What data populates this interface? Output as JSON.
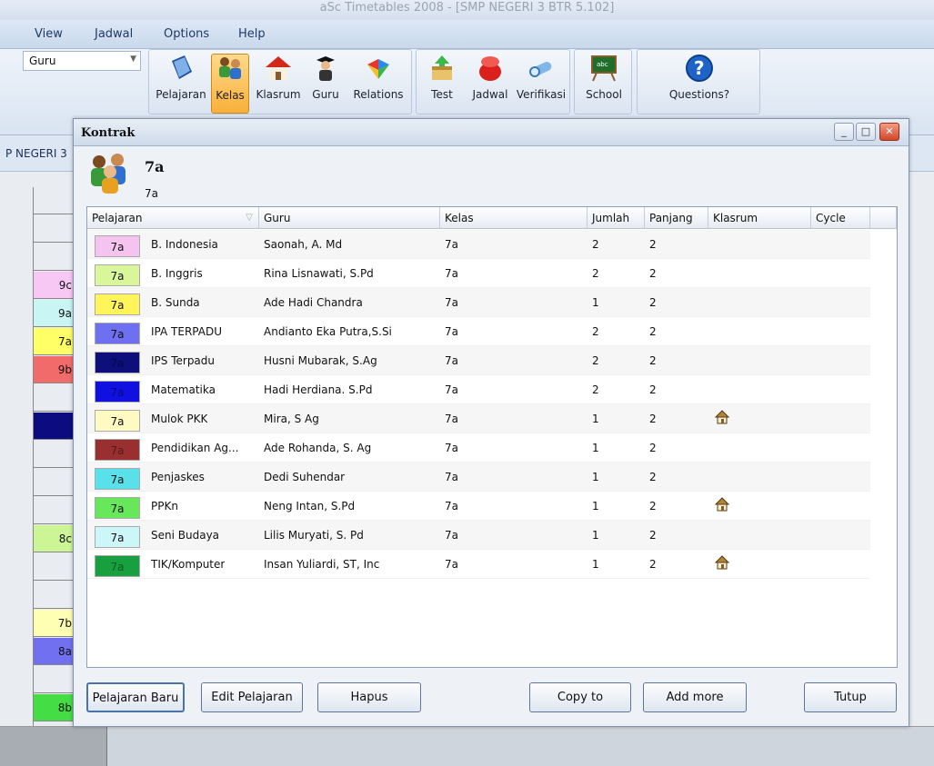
{
  "app": {
    "window_title": "aSc Timetables 2008 - [SMP NEGERI 3 BTR 5.102]",
    "menu": [
      "View",
      "Jadwal",
      "Options",
      "Help"
    ],
    "view_combo": "Guru",
    "school_fragment": "P NEGERI 3"
  },
  "ribbon": {
    "buttons": [
      {
        "label": "Pelajaran",
        "icon": "book-icon"
      },
      {
        "label": "Kelas",
        "icon": "class-students-icon",
        "active": true
      },
      {
        "label": "Klasrum",
        "icon": "house-icon"
      },
      {
        "label": "Guru",
        "icon": "teacher-icon"
      },
      {
        "label": "Relations",
        "icon": "relations-icon"
      },
      {
        "label": "Test",
        "icon": "test-icon"
      },
      {
        "label": "Jadwal",
        "icon": "jadwal-icon"
      },
      {
        "label": "Verifikasi",
        "icon": "verify-icon"
      },
      {
        "label": "School",
        "icon": "blackboard-icon"
      },
      {
        "label": "Questions?",
        "icon": "help-icon"
      }
    ]
  },
  "background_grid": {
    "left_cells": [
      {
        "text": "",
        "color": ""
      },
      {
        "text": "",
        "color": ""
      },
      {
        "text": "",
        "color": ""
      },
      {
        "text": "9c",
        "color": "#f7c8f4"
      },
      {
        "text": "9a",
        "color": "#c9f5f5"
      },
      {
        "text": "7a",
        "color": "#ffff66"
      },
      {
        "text": "9b",
        "color": "#f26b6b"
      },
      {
        "text": "",
        "color": ""
      },
      {
        "text": "",
        "color": "#0c0c80"
      },
      {
        "text": "",
        "color": ""
      },
      {
        "text": "",
        "color": ""
      },
      {
        "text": "",
        "color": ""
      },
      {
        "text": "8c",
        "color": "#ccf596"
      },
      {
        "text": "",
        "color": ""
      },
      {
        "text": "",
        "color": ""
      },
      {
        "text": "7b",
        "color": "#ffffb3"
      },
      {
        "text": "8a",
        "color": "#7070f0"
      },
      {
        "text": "",
        "color": ""
      },
      {
        "text": "8b",
        "color": "#44dd44"
      }
    ]
  },
  "dialog": {
    "title": "Kontrak",
    "class_name": "7a",
    "class_short": "7a",
    "columns": [
      "Pelajaran",
      "Guru",
      "Kelas",
      "Jumlah",
      "Panjang",
      "Klasrum",
      "Cycle"
    ],
    "rows": [
      {
        "swatch_label": "7a",
        "swatch_color": "#f5c3f0",
        "pelajaran": "B. Indonesia",
        "guru": "Saonah, A. Md",
        "kelas": "7a",
        "jumlah": "2",
        "panjang": "2",
        "klasrum": false
      },
      {
        "swatch_label": "7a",
        "swatch_color": "#d9f79a",
        "pelajaran": "B. Inggris",
        "guru": "Rina Lisnawati, S.Pd",
        "kelas": "7a",
        "jumlah": "2",
        "panjang": "2",
        "klasrum": false
      },
      {
        "swatch_label": "7a",
        "swatch_color": "#fff45a",
        "pelajaran": "B. Sunda",
        "guru": "Ade Hadi Chandra",
        "kelas": "7a",
        "jumlah": "1",
        "panjang": "2",
        "klasrum": false
      },
      {
        "swatch_label": "7a",
        "swatch_color": "#6f6ff2",
        "pelajaran": "IPA TERPADU",
        "guru": "Andianto Eka Putra,S.Si",
        "kelas": "7a",
        "jumlah": "2",
        "panjang": "2",
        "klasrum": false
      },
      {
        "swatch_label": "7a",
        "swatch_color": "#0e0e7d",
        "pelajaran": "IPS Terpadu",
        "guru": "Husni Mubarak, S.Ag",
        "kelas": "7a",
        "jumlah": "2",
        "panjang": "2",
        "klasrum": false
      },
      {
        "swatch_label": "7a",
        "swatch_color": "#1010e0",
        "pelajaran": "Matematika",
        "guru": "Hadi Herdiana. S.Pd",
        "kelas": "7a",
        "jumlah": "2",
        "panjang": "2",
        "klasrum": false
      },
      {
        "swatch_label": "7a",
        "swatch_color": "#fff9c2",
        "pelajaran": "Mulok PKK",
        "guru": "Mira, S Ag",
        "kelas": "7a",
        "jumlah": "1",
        "panjang": "2",
        "klasrum": true
      },
      {
        "swatch_label": "7a",
        "swatch_color": "#9a2f2f",
        "pelajaran": "Pendidikan Ag...",
        "guru": "Ade Rohanda, S. Ag",
        "kelas": "7a",
        "jumlah": "1",
        "panjang": "2",
        "klasrum": false
      },
      {
        "swatch_label": "7a",
        "swatch_color": "#58e1ea",
        "pelajaran": "Penjaskes",
        "guru": "Dedi Suhendar",
        "kelas": "7a",
        "jumlah": "1",
        "panjang": "2",
        "klasrum": false
      },
      {
        "swatch_label": "7a",
        "swatch_color": "#66e85a",
        "pelajaran": "PPKn",
        "guru": "Neng Intan, S.Pd",
        "kelas": "7a",
        "jumlah": "1",
        "panjang": "2",
        "klasrum": true
      },
      {
        "swatch_label": "7a",
        "swatch_color": "#cdf6f8",
        "pelajaran": "Seni Budaya",
        "guru": "Lilis Muryati, S. Pd",
        "kelas": "7a",
        "jumlah": "1",
        "panjang": "2",
        "klasrum": false
      },
      {
        "swatch_label": "7a",
        "swatch_color": "#18a040",
        "pelajaran": "TIK/Komputer",
        "guru": "Insan Yuliardi, ST, Inc",
        "kelas": "7a",
        "jumlah": "1",
        "panjang": "2",
        "klasrum": true
      }
    ],
    "buttons": {
      "new": "Pelajaran Baru",
      "edit": "Edit Pelajaran",
      "delete": "Hapus",
      "copy": "Copy to",
      "add_more": "Add more",
      "close": "Tutup"
    }
  }
}
